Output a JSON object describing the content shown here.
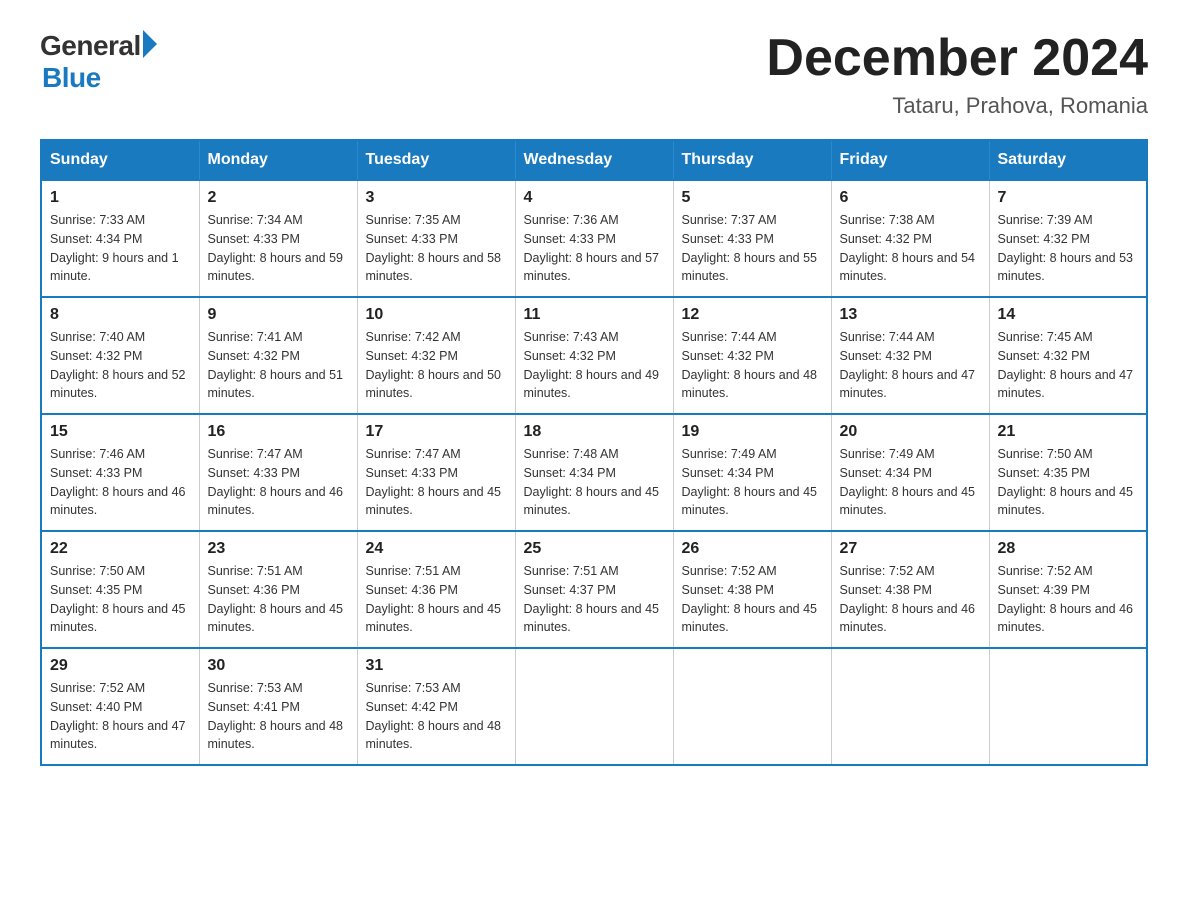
{
  "logo": {
    "general": "General",
    "blue": "Blue"
  },
  "title": "December 2024",
  "location": "Tataru, Prahova, Romania",
  "days_of_week": [
    "Sunday",
    "Monday",
    "Tuesday",
    "Wednesday",
    "Thursday",
    "Friday",
    "Saturday"
  ],
  "weeks": [
    [
      {
        "day": "1",
        "sunrise": "7:33 AM",
        "sunset": "4:34 PM",
        "daylight": "9 hours and 1 minute."
      },
      {
        "day": "2",
        "sunrise": "7:34 AM",
        "sunset": "4:33 PM",
        "daylight": "8 hours and 59 minutes."
      },
      {
        "day": "3",
        "sunrise": "7:35 AM",
        "sunset": "4:33 PM",
        "daylight": "8 hours and 58 minutes."
      },
      {
        "day": "4",
        "sunrise": "7:36 AM",
        "sunset": "4:33 PM",
        "daylight": "8 hours and 57 minutes."
      },
      {
        "day": "5",
        "sunrise": "7:37 AM",
        "sunset": "4:33 PM",
        "daylight": "8 hours and 55 minutes."
      },
      {
        "day": "6",
        "sunrise": "7:38 AM",
        "sunset": "4:32 PM",
        "daylight": "8 hours and 54 minutes."
      },
      {
        "day": "7",
        "sunrise": "7:39 AM",
        "sunset": "4:32 PM",
        "daylight": "8 hours and 53 minutes."
      }
    ],
    [
      {
        "day": "8",
        "sunrise": "7:40 AM",
        "sunset": "4:32 PM",
        "daylight": "8 hours and 52 minutes."
      },
      {
        "day": "9",
        "sunrise": "7:41 AM",
        "sunset": "4:32 PM",
        "daylight": "8 hours and 51 minutes."
      },
      {
        "day": "10",
        "sunrise": "7:42 AM",
        "sunset": "4:32 PM",
        "daylight": "8 hours and 50 minutes."
      },
      {
        "day": "11",
        "sunrise": "7:43 AM",
        "sunset": "4:32 PM",
        "daylight": "8 hours and 49 minutes."
      },
      {
        "day": "12",
        "sunrise": "7:44 AM",
        "sunset": "4:32 PM",
        "daylight": "8 hours and 48 minutes."
      },
      {
        "day": "13",
        "sunrise": "7:44 AM",
        "sunset": "4:32 PM",
        "daylight": "8 hours and 47 minutes."
      },
      {
        "day": "14",
        "sunrise": "7:45 AM",
        "sunset": "4:32 PM",
        "daylight": "8 hours and 47 minutes."
      }
    ],
    [
      {
        "day": "15",
        "sunrise": "7:46 AM",
        "sunset": "4:33 PM",
        "daylight": "8 hours and 46 minutes."
      },
      {
        "day": "16",
        "sunrise": "7:47 AM",
        "sunset": "4:33 PM",
        "daylight": "8 hours and 46 minutes."
      },
      {
        "day": "17",
        "sunrise": "7:47 AM",
        "sunset": "4:33 PM",
        "daylight": "8 hours and 45 minutes."
      },
      {
        "day": "18",
        "sunrise": "7:48 AM",
        "sunset": "4:34 PM",
        "daylight": "8 hours and 45 minutes."
      },
      {
        "day": "19",
        "sunrise": "7:49 AM",
        "sunset": "4:34 PM",
        "daylight": "8 hours and 45 minutes."
      },
      {
        "day": "20",
        "sunrise": "7:49 AM",
        "sunset": "4:34 PM",
        "daylight": "8 hours and 45 minutes."
      },
      {
        "day": "21",
        "sunrise": "7:50 AM",
        "sunset": "4:35 PM",
        "daylight": "8 hours and 45 minutes."
      }
    ],
    [
      {
        "day": "22",
        "sunrise": "7:50 AM",
        "sunset": "4:35 PM",
        "daylight": "8 hours and 45 minutes."
      },
      {
        "day": "23",
        "sunrise": "7:51 AM",
        "sunset": "4:36 PM",
        "daylight": "8 hours and 45 minutes."
      },
      {
        "day": "24",
        "sunrise": "7:51 AM",
        "sunset": "4:36 PM",
        "daylight": "8 hours and 45 minutes."
      },
      {
        "day": "25",
        "sunrise": "7:51 AM",
        "sunset": "4:37 PM",
        "daylight": "8 hours and 45 minutes."
      },
      {
        "day": "26",
        "sunrise": "7:52 AM",
        "sunset": "4:38 PM",
        "daylight": "8 hours and 45 minutes."
      },
      {
        "day": "27",
        "sunrise": "7:52 AM",
        "sunset": "4:38 PM",
        "daylight": "8 hours and 46 minutes."
      },
      {
        "day": "28",
        "sunrise": "7:52 AM",
        "sunset": "4:39 PM",
        "daylight": "8 hours and 46 minutes."
      }
    ],
    [
      {
        "day": "29",
        "sunrise": "7:52 AM",
        "sunset": "4:40 PM",
        "daylight": "8 hours and 47 minutes."
      },
      {
        "day": "30",
        "sunrise": "7:53 AM",
        "sunset": "4:41 PM",
        "daylight": "8 hours and 48 minutes."
      },
      {
        "day": "31",
        "sunrise": "7:53 AM",
        "sunset": "4:42 PM",
        "daylight": "8 hours and 48 minutes."
      },
      null,
      null,
      null,
      null
    ]
  ],
  "labels": {
    "sunrise": "Sunrise:",
    "sunset": "Sunset:",
    "daylight": "Daylight:"
  }
}
